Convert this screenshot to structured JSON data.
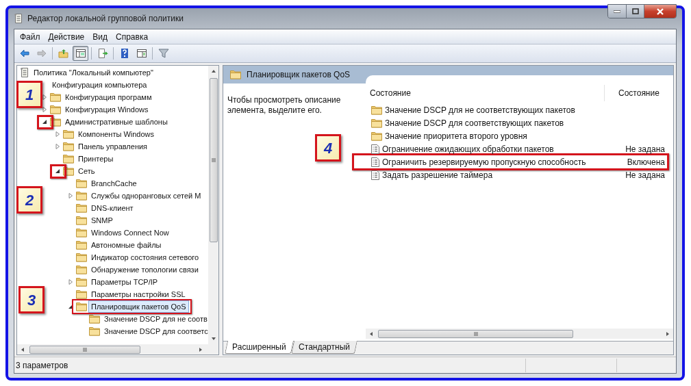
{
  "window": {
    "title": "Редактор локальной групповой политики"
  },
  "menu": [
    {
      "label": "Файл"
    },
    {
      "label": "Действие"
    },
    {
      "label": "Вид"
    },
    {
      "label": "Справка"
    }
  ],
  "toolbar": [
    {
      "disabled": false,
      "pressed": false
    },
    {
      "disabled": true,
      "pressed": false
    },
    {
      "disabled": false,
      "pressed": false
    },
    {
      "disabled": false,
      "pressed": true
    },
    {
      "disabled": false,
      "pressed": false
    },
    {
      "disabled": false,
      "pressed": false
    },
    {
      "disabled": false,
      "pressed": false
    },
    {
      "disabled": false,
      "pressed": false
    }
  ],
  "tree": [
    {
      "label": "Политика \"Локальный компьютер\"",
      "kind": "policy",
      "selected": false,
      "children": [
        {
          "label": "Конфигурация компьютера",
          "selected": false,
          "children": [
            {
              "label": "Конфигурация программ",
              "kind": "folder",
              "expanded": false,
              "selected": false
            },
            {
              "label": "Конфигурация Windows",
              "kind": "folder",
              "expanded": false,
              "selected": false
            },
            {
              "label": "Административные шаблоны",
              "kind": "folder",
              "expanded": true,
              "selected": false,
              "expander_marked": true,
              "children": [
                {
                  "label": "Компоненты Windows",
                  "kind": "folder",
                  "expanded": false,
                  "selected": false
                },
                {
                  "label": "Панель управления",
                  "kind": "folder",
                  "expanded": false,
                  "selected": false
                },
                {
                  "label": "Принтеры",
                  "kind": "folder",
                  "selected": false
                },
                {
                  "label": "Сеть",
                  "kind": "folder",
                  "expanded": true,
                  "selected": false,
                  "expander_marked": true,
                  "children": [
                    {
                      "label": "BranchCache",
                      "kind": "folder",
                      "selected": false
                    },
                    {
                      "label": "Службы одноранговых сетей М",
                      "kind": "folder",
                      "expanded": false,
                      "selected": false
                    },
                    {
                      "label": "DNS-клиент",
                      "kind": "folder",
                      "selected": false
                    },
                    {
                      "label": "SNMP",
                      "kind": "folder",
                      "selected": false
                    },
                    {
                      "label": "Windows Connect Now",
                      "kind": "folder",
                      "selected": false
                    },
                    {
                      "label": "Автономные файлы",
                      "kind": "folder",
                      "selected": false
                    },
                    {
                      "label": "Индикатор состояния сетевого",
                      "kind": "folder",
                      "selected": false
                    },
                    {
                      "label": "Обнаружение топологии связи",
                      "kind": "folder",
                      "selected": false
                    },
                    {
                      "label": "Параметры TCP/IP",
                      "kind": "folder",
                      "expanded": false,
                      "selected": false
                    },
                    {
                      "label": "Параметры настройки SSL",
                      "kind": "folder",
                      "selected": false
                    },
                    {
                      "label": "Планировщик пакетов QoS",
                      "kind": "folder",
                      "expanded": true,
                      "selected": true,
                      "label_marked": true,
                      "children": [
                        {
                          "label": "Значение DSCP для не соотв",
                          "kind": "folder",
                          "selected": false
                        },
                        {
                          "label": "Значение DSCP для соответс",
                          "kind": "folder",
                          "selected": false
                        }
                      ]
                    }
                  ]
                }
              ]
            }
          ]
        }
      ]
    }
  ],
  "details": {
    "title": "Планировщик пакетов QoS",
    "description": "Чтобы просмотреть описание элемента, выделите его.",
    "columns": [
      "Состояние",
      "Состояние"
    ],
    "rows": [
      {
        "kind": "folder",
        "name": "Значение DSCP для не соответствующих пакетов",
        "selected": false
      },
      {
        "kind": "folder",
        "name": "Значение DSCP для соответствующих пакетов",
        "selected": false
      },
      {
        "kind": "folder",
        "name": "Значение приоритета второго уровня",
        "selected": false
      },
      {
        "kind": "setting",
        "name": "Ограничение ожидающих обработки пакетов",
        "state": "Не задана",
        "selected": false
      },
      {
        "kind": "setting",
        "name": "Ограничить резервируемую пропускную способность",
        "state": "Включена",
        "selected": false,
        "highlighted": true
      },
      {
        "kind": "setting",
        "name": "Задать разрешение таймера",
        "state": "Не задана",
        "selected": false
      }
    ]
  },
  "view_tabs": [
    {
      "label": "Расширенный",
      "selected": true
    },
    {
      "label": "Стандартный",
      "selected": false
    }
  ],
  "status_bar": {
    "text": "3 параметров"
  },
  "callouts": [
    {
      "label": "1"
    },
    {
      "label": "2"
    },
    {
      "label": "3"
    },
    {
      "label": "4"
    }
  ]
}
